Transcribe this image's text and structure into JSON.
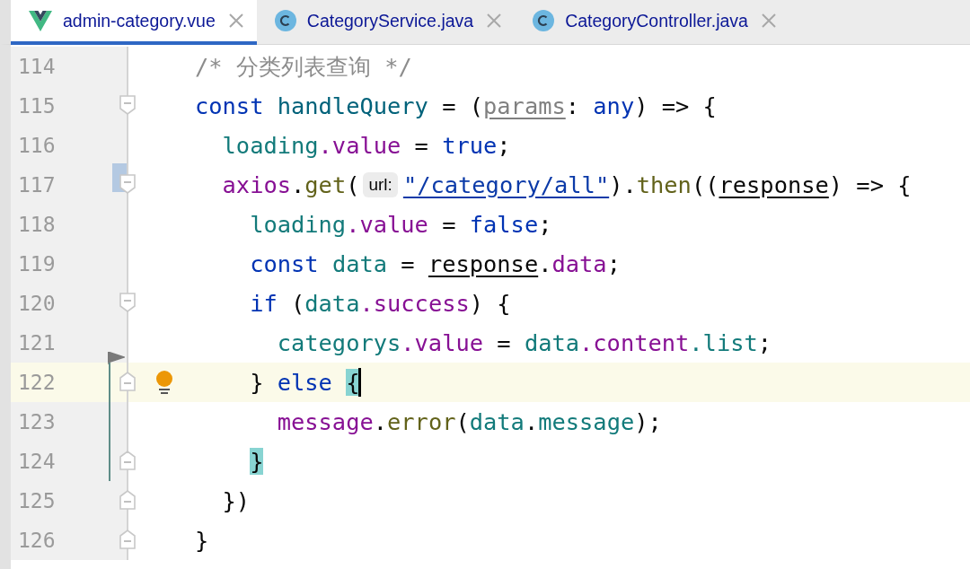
{
  "tabs": [
    {
      "label": "admin-category.vue",
      "kind": "vue",
      "selected": true
    },
    {
      "label": "CategoryService.java",
      "kind": "class",
      "selected": false
    },
    {
      "label": "CategoryController.java",
      "kind": "class",
      "selected": false
    }
  ],
  "lines": [
    {
      "number": "114",
      "fold_start": false,
      "fold_end": false,
      "modified": false,
      "changed": false,
      "current": false,
      "tokens": [
        {
          "text": "/* 分类列表查询 */",
          "kind": "comment"
        }
      ]
    },
    {
      "number": "115",
      "fold_start": true,
      "fold_end": false,
      "modified": false,
      "changed": false,
      "current": false,
      "tokens": [
        {
          "text": "const ",
          "kind": "keyword"
        },
        {
          "text": "handleQuery",
          "kind": "function"
        },
        {
          "text": " = (",
          "kind": "plain"
        },
        {
          "text": "params",
          "kind": "unused-param"
        },
        {
          "text": ": ",
          "kind": "plain"
        },
        {
          "text": "any",
          "kind": "keyword"
        },
        {
          "text": ") => {",
          "kind": "plain"
        }
      ]
    },
    {
      "number": "116",
      "fold_start": false,
      "fold_end": false,
      "modified": false,
      "changed": false,
      "current": false,
      "tokens": [
        {
          "text": "  loading",
          "kind": "local"
        },
        {
          "text": ".value",
          "kind": "member"
        },
        {
          "text": " = ",
          "kind": "plain"
        },
        {
          "text": "true",
          "kind": "keyword"
        },
        {
          "text": ";",
          "kind": "plain"
        }
      ]
    },
    {
      "number": "117",
      "fold_start": true,
      "fold_end": false,
      "modified": true,
      "changed": false,
      "current": false,
      "tokens": [
        {
          "text": "  axios",
          "kind": "member"
        },
        {
          "text": ".",
          "kind": "plain"
        },
        {
          "text": "get",
          "kind": "method"
        },
        {
          "text": "(",
          "kind": "plain"
        },
        {
          "text": "url:",
          "kind": "hint"
        },
        {
          "text": "\"/category/all\"",
          "kind": "string"
        },
        {
          "text": ").",
          "kind": "plain"
        },
        {
          "text": "then",
          "kind": "method"
        },
        {
          "text": "((",
          "kind": "plain"
        },
        {
          "text": "response",
          "kind": "param"
        },
        {
          "text": ") => {",
          "kind": "plain"
        }
      ]
    },
    {
      "number": "118",
      "fold_start": false,
      "fold_end": false,
      "modified": false,
      "changed": false,
      "current": false,
      "tokens": [
        {
          "text": "    loading",
          "kind": "local"
        },
        {
          "text": ".value",
          "kind": "member"
        },
        {
          "text": " = ",
          "kind": "plain"
        },
        {
          "text": "false",
          "kind": "keyword"
        },
        {
          "text": ";",
          "kind": "plain"
        }
      ]
    },
    {
      "number": "119",
      "fold_start": false,
      "fold_end": false,
      "modified": false,
      "changed": false,
      "current": false,
      "tokens": [
        {
          "text": "    const ",
          "kind": "keyword"
        },
        {
          "text": "data",
          "kind": "local"
        },
        {
          "text": " = ",
          "kind": "plain"
        },
        {
          "text": "response",
          "kind": "param"
        },
        {
          "text": ".",
          "kind": "plain"
        },
        {
          "text": "data",
          "kind": "member"
        },
        {
          "text": ";",
          "kind": "plain"
        }
      ]
    },
    {
      "number": "120",
      "fold_start": true,
      "fold_end": false,
      "modified": false,
      "changed": false,
      "current": false,
      "tokens": [
        {
          "text": "    if",
          "kind": "keyword"
        },
        {
          "text": " (",
          "kind": "plain"
        },
        {
          "text": "data",
          "kind": "local"
        },
        {
          "text": ".success",
          "kind": "member"
        },
        {
          "text": ") {",
          "kind": "plain"
        }
      ]
    },
    {
      "number": "121",
      "fold_start": false,
      "fold_end": false,
      "modified": false,
      "changed": false,
      "current": false,
      "tokens": [
        {
          "text": "      categorys",
          "kind": "local"
        },
        {
          "text": ".value",
          "kind": "member"
        },
        {
          "text": " = ",
          "kind": "plain"
        },
        {
          "text": "data",
          "kind": "local"
        },
        {
          "text": ".content",
          "kind": "member"
        },
        {
          "text": ".list",
          "kind": "local"
        },
        {
          "text": ";",
          "kind": "plain"
        }
      ]
    },
    {
      "number": "122",
      "fold_start": false,
      "fold_end": true,
      "modified": false,
      "changed": true,
      "current": true,
      "tokens": [
        {
          "text": "    } ",
          "kind": "plain"
        },
        {
          "text": "else",
          "kind": "keyword"
        },
        {
          "text": " {",
          "kind": "brace-match"
        }
      ]
    },
    {
      "number": "123",
      "fold_start": false,
      "fold_end": false,
      "modified": false,
      "changed": true,
      "current": false,
      "tokens": [
        {
          "text": "      message",
          "kind": "member"
        },
        {
          "text": ".",
          "kind": "plain"
        },
        {
          "text": "error",
          "kind": "method"
        },
        {
          "text": "(",
          "kind": "plain"
        },
        {
          "text": "data",
          "kind": "local"
        },
        {
          "text": ".",
          "kind": "plain"
        },
        {
          "text": "message",
          "kind": "local"
        },
        {
          "text": ");",
          "kind": "plain"
        }
      ]
    },
    {
      "number": "124",
      "fold_start": false,
      "fold_end": true,
      "modified": false,
      "changed": true,
      "current": false,
      "tokens": [
        {
          "text": "    }",
          "kind": "brace-match"
        }
      ]
    },
    {
      "number": "125",
      "fold_start": false,
      "fold_end": true,
      "modified": false,
      "changed": false,
      "current": false,
      "tokens": [
        {
          "text": "  })",
          "kind": "plain"
        }
      ]
    },
    {
      "number": "126",
      "fold_start": false,
      "fold_end": true,
      "modified": false,
      "changed": false,
      "current": false,
      "tokens": [
        {
          "text": "}",
          "kind": "plain"
        }
      ]
    }
  ]
}
